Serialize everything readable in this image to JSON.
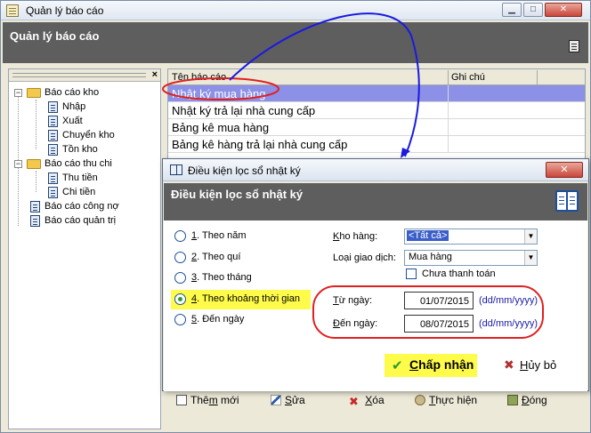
{
  "main_window": {
    "title": "Quản lý báo cáo",
    "header_title": "Quản lý báo cáo",
    "controls": {
      "minimize": "▁",
      "maximize": "□",
      "close": "✕"
    }
  },
  "tree": {
    "close_glyph": "×",
    "nodes": [
      {
        "label": "Báo cáo kho",
        "type": "folder",
        "toggle": "−"
      },
      {
        "label": "Nhập",
        "type": "doc"
      },
      {
        "label": "Xuất",
        "type": "doc"
      },
      {
        "label": "Chuyển kho",
        "type": "doc"
      },
      {
        "label": "Tồn kho",
        "type": "doc"
      },
      {
        "label": "Báo cáo thu chi",
        "type": "folder",
        "toggle": "−"
      },
      {
        "label": "Thu tiền",
        "type": "doc"
      },
      {
        "label": "Chi tiền",
        "type": "doc"
      },
      {
        "label": "Báo cáo công nợ",
        "type": "root-doc"
      },
      {
        "label": "Báo cáo quản trị",
        "type": "root-doc"
      }
    ]
  },
  "report_list": {
    "columns": [
      "Tên báo cáo",
      "Ghi chú"
    ],
    "rows": [
      {
        "name": "Nhật ký mua hàng",
        "selected": true
      },
      {
        "name": "Nhật ký trả lại nhà cung cấp",
        "selected": false
      },
      {
        "name": "Bảng kê mua hàng",
        "selected": false
      },
      {
        "name": "Bảng kê hàng trả lại nhà cung cấp",
        "selected": false
      }
    ]
  },
  "toolbar": {
    "new_pre": "Thê",
    "new_u": "m",
    "new_post": " mới",
    "edit_u": "S",
    "edit_post": "ửa",
    "delete_u": "X",
    "delete_post": "óa",
    "run_u": "T",
    "run_post": "hực hiện",
    "close_u": "Đ",
    "close_post": "óng"
  },
  "dialog": {
    "title": "Điều kiện lọc sổ nhật ký",
    "header_title": "Điều kiện lọc sổ nhật ký",
    "close_glyph": "✕",
    "options": [
      {
        "num": "1",
        "text": ". Theo năm",
        "checked": false
      },
      {
        "num": "2",
        "text": ". Theo quí",
        "checked": false
      },
      {
        "num": "3",
        "text": ". Theo tháng",
        "checked": false
      },
      {
        "num": "4",
        "text": ". Theo khoảng thời gian",
        "checked": true
      },
      {
        "num": "5",
        "text": ". Đến ngày",
        "checked": false
      }
    ],
    "kho_hang": {
      "label_u": "K",
      "label_post": "ho hàng:",
      "value": "<Tất cả>"
    },
    "loai_giao_dich": {
      "label_pre": "Loại ",
      "label_u": "g",
      "label_post": "iao dịch:",
      "value": "Mua hàng"
    },
    "chua_thanh_toan": {
      "label": "Chưa thanh toán",
      "checked": false
    },
    "tu_ngay": {
      "label_u": "T",
      "label_post": "ừ ngày:",
      "value": "01/07/2015",
      "format": "(dd/mm/yyyy)"
    },
    "den_ngay": {
      "label_u": "Đ",
      "label_post": "ến ngày:",
      "value": "08/07/2015",
      "format": "(dd/mm/yyyy)"
    },
    "ok": {
      "u": "C",
      "post": "hấp nhận",
      "glyph": "✔"
    },
    "cancel": {
      "u": "H",
      "post": "ủy bỏ",
      "glyph": "✖"
    }
  },
  "colors": {
    "header_band": "#5e5e5e",
    "selection": "#8c90e6",
    "highlight_yellow": "#fffb4a",
    "annotation_red": "#e02020",
    "annotation_blue": "#1a1ae0"
  }
}
